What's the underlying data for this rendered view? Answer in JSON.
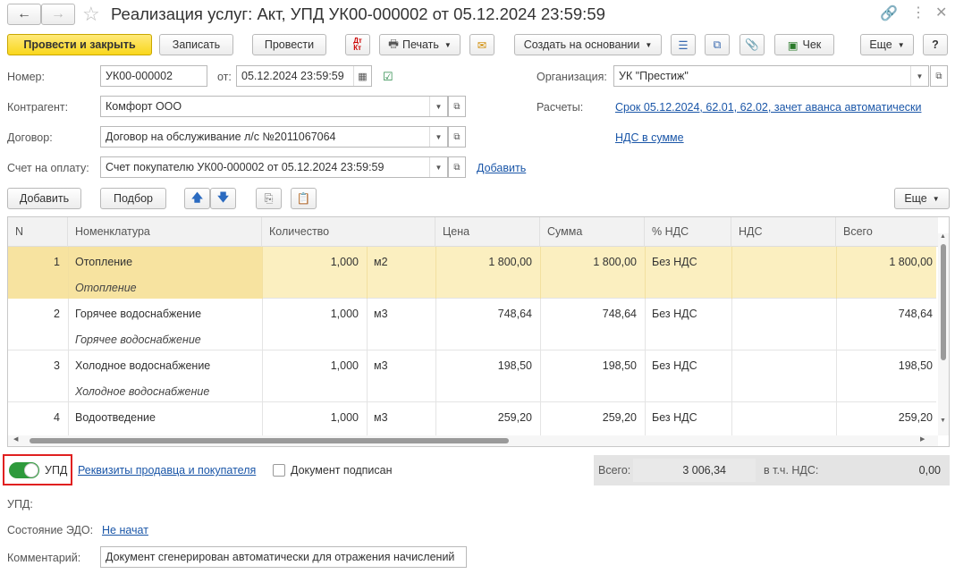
{
  "window": {
    "title": "Реализация услуг: Акт, УПД УК00-000002 от 05.12.2024 23:59:59"
  },
  "toolbar": {
    "post_close": "Провести и закрыть",
    "save": "Записать",
    "post": "Провести",
    "print": "Печать",
    "create_based": "Создать на основании",
    "check": "Чек",
    "more": "Еще",
    "help": "?"
  },
  "form": {
    "number_label": "Номер:",
    "number_value": "УК00-000002",
    "date_label": "от:",
    "date_value": "05.12.2024 23:59:59",
    "org_label": "Организация:",
    "org_value": "УК \"Престиж\"",
    "counterparty_label": "Контрагент:",
    "counterparty_value": "Комфорт ООО",
    "settlements_label": "Расчеты:",
    "settlements_link": "Срок 05.12.2024, 62.01, 62.02, зачет аванса автоматически",
    "contract_label": "Договор:",
    "contract_value": "Договор на обслуживание л/с №2011067064",
    "vat_link": "НДС в сумме",
    "invoice_label": "Счет на оплату:",
    "invoice_value": "Счет покупателю УК00-000002 от 05.12.2024 23:59:59",
    "invoice_add": "Добавить"
  },
  "table_toolbar": {
    "add": "Добавить",
    "select": "Подбор",
    "more": "Еще"
  },
  "table": {
    "headers": [
      "N",
      "Номенклатура",
      "Количество",
      "Цена",
      "Сумма",
      "% НДС",
      "НДС",
      "Всего"
    ],
    "rows": [
      {
        "n": "1",
        "name": "Отопление",
        "sub": "Отопление",
        "qty": "1,000",
        "unit": "м2",
        "price": "1 800,00",
        "sum": "1 800,00",
        "vat_rate": "Без НДС",
        "vat": "",
        "total": "1 800,00"
      },
      {
        "n": "2",
        "name": "Горячее водоснабжение",
        "sub": "Горячее водоснабжение",
        "qty": "1,000",
        "unit": "м3",
        "price": "748,64",
        "sum": "748,64",
        "vat_rate": "Без НДС",
        "vat": "",
        "total": "748,64"
      },
      {
        "n": "3",
        "name": "Холодное водоснабжение",
        "sub": "Холодное водоснабжение",
        "qty": "1,000",
        "unit": "м3",
        "price": "198,50",
        "sum": "198,50",
        "vat_rate": "Без НДС",
        "vat": "",
        "total": "198,50"
      },
      {
        "n": "4",
        "name": "Водоотведение",
        "sub": "",
        "qty": "1,000",
        "unit": "м3",
        "price": "259,20",
        "sum": "259,20",
        "vat_rate": "Без НДС",
        "vat": "",
        "total": "259,20"
      }
    ]
  },
  "footer": {
    "upd_toggle_label": "УПД",
    "requisites_link": "Реквизиты продавца и покупателя",
    "signed_label": "Документ подписан",
    "total_label": "Всего:",
    "total_value": "3 006,34",
    "vat_label": "в т.ч. НДС:",
    "vat_value": "0,00",
    "upd_label": "УПД:",
    "edo_label": "Состояние ЭДО:",
    "edo_link": "Не начат",
    "comment_label": "Комментарий:",
    "comment_value": "Документ сгенерирован автоматически для отражения начислений"
  },
  "colors": {
    "primary": "#f9d71c",
    "selected_row": "#fbefc0",
    "link": "#1a56a8",
    "toggle_on": "#2e9a3c",
    "highlight_box": "#e02020"
  }
}
